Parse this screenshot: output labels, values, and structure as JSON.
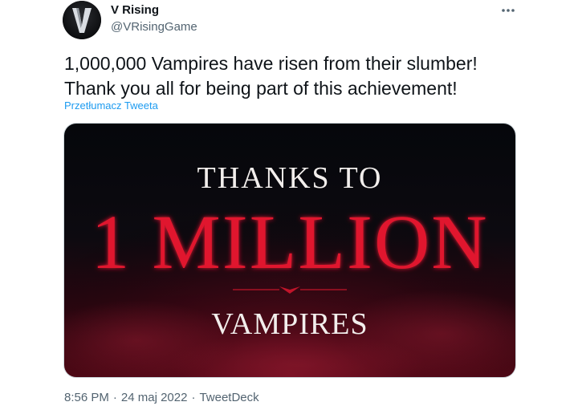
{
  "author": {
    "display_name": "V Rising",
    "handle": "@VRisingGame",
    "avatar_icon": "v-rising-logo-icon",
    "avatar_letter": "V"
  },
  "more_options_icon": "more-horizontal-icon",
  "tweet": {
    "text_lines": [
      "1,000,000 Vampires have risen from their slumber!",
      "Thank you all for being part of this achievement!"
    ],
    "translate_label": "Przetłumacz Tweeta"
  },
  "media": {
    "line1": "THANKS TO",
    "line2": "1 MILLION",
    "line3": "VAMPIRES",
    "colors": {
      "background_top": "#05070b",
      "background_bottom": "#5a0a18",
      "headline_red": "#e0192f",
      "white_text": "#f2eeec"
    }
  },
  "meta": {
    "time": "8:56 PM",
    "date": "24 maj 2022",
    "separator": "·",
    "source": "TweetDeck"
  },
  "colors": {
    "primary_text": "#0f1419",
    "secondary_text": "#536471",
    "link": "#1d9bf0",
    "border": "#cfd9de"
  }
}
